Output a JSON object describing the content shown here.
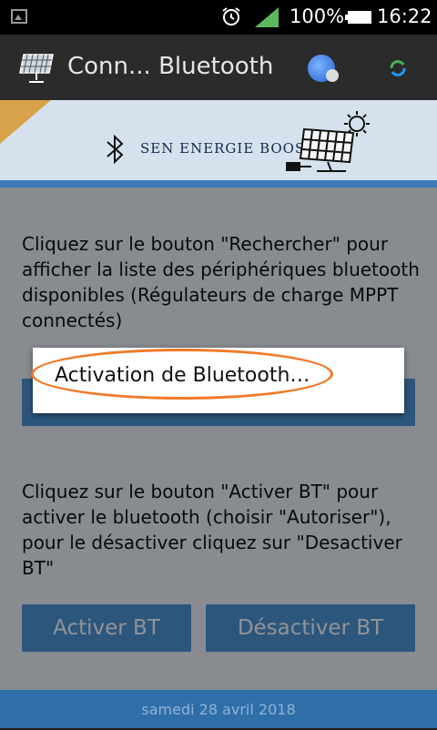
{
  "status_bar": {
    "battery_text": "100%",
    "time": "16:22"
  },
  "action_bar": {
    "title": "Conn... Bluetooth"
  },
  "banner": {
    "brand": "SEN ENERGIE BOOSTER"
  },
  "instructions": {
    "search": "Cliquez sur le bouton \"Rechercher\" pour afficher la liste des périphériques bluetooth disponibles (Régulateurs de charge MPPT connectés)",
    "activate": "Cliquez sur le bouton \"Activer BT\" pour activer le bluetooth (choisir \"Autoriser\"), pour le désactiver cliquez sur \"Desactiver BT\""
  },
  "buttons": {
    "activate": "Activer BT",
    "deactivate": "Désactiver BT"
  },
  "dialog": {
    "message": "Activation de Bluetooth…"
  },
  "footer": {
    "date": "samedi 28 avril 2018"
  },
  "colors": {
    "accent": "#4a8cc9",
    "highlight": "#f07a2a"
  },
  "icons": [
    "gallery-icon",
    "alarm-icon",
    "signal-icon",
    "battery-icon",
    "solar-panel-logo-icon",
    "search-globe-icon",
    "refresh-icon",
    "bluetooth-icon"
  ]
}
